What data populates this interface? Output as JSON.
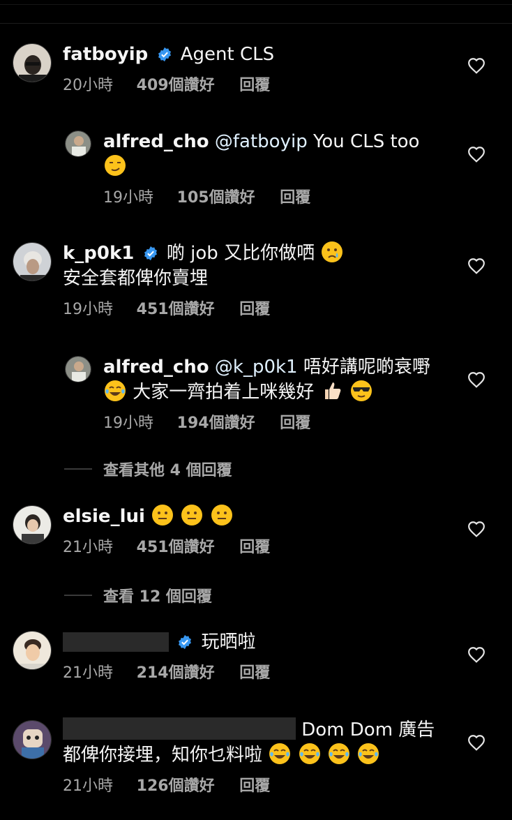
{
  "comments": [
    {
      "username": "fatboyip",
      "verified": true,
      "text": "Agent CLS",
      "time": "20小時",
      "likes": "409個讚好",
      "reply": "回覆"
    },
    {
      "username": "alfred_cho",
      "mention": "@fatboyip",
      "text": "You CLS too",
      "time": "19小時",
      "likes": "105個讚好",
      "reply": "回覆"
    },
    {
      "username": "k_p0k1",
      "verified": true,
      "text": "啲 job 又比你做哂",
      "text2": "安全套都俾你賣埋",
      "time": "19小時",
      "likes": "451個讚好",
      "reply": "回覆"
    },
    {
      "username": "alfred_cho",
      "mention": "@k_p0k1",
      "text": "唔好講呢啲衰嘢",
      "text2": "大家一齊拍着上咪幾好",
      "time": "19小時",
      "likes": "194個讚好",
      "reply": "回覆"
    },
    {
      "username": "elsie_lui",
      "time": "21小時",
      "likes": "451個讚好",
      "reply": "回覆"
    },
    {
      "verified": true,
      "text": "玩晒啦",
      "time": "21小時",
      "likes": "214個讚好",
      "reply": "回覆"
    },
    {
      "text": "Dom Dom 廣告",
      "text2": "都俾你接埋，知你乜料啦",
      "time": "21小時",
      "likes": "126個讚好",
      "reply": "回覆"
    }
  ],
  "view_more_1": "查看其他 4 個回覆",
  "view_more_2": "查看 12 個回覆",
  "colors": {
    "background": "#000000",
    "text": "#f5f5f5",
    "muted": "#a8a8a8",
    "verified": "#3897f0"
  }
}
